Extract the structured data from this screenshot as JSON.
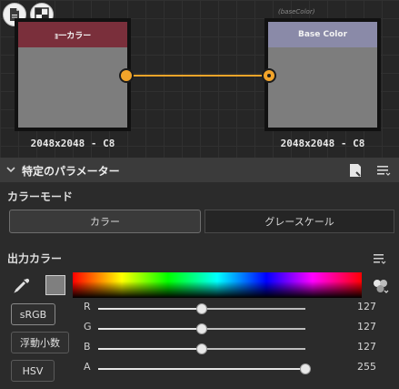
{
  "graph": {
    "left_node": {
      "header_label": "ｮ一カラー",
      "header_color": "#7a2f3b",
      "resolution": "2048x2048 - C8"
    },
    "right_node": {
      "tag": "(baseColor)",
      "header_label": "Base Color",
      "header_color": "#8a8aa8",
      "resolution": "2048x2048 - C8"
    },
    "wire_color": "#f2a42a"
  },
  "panel": {
    "title": "特定のパラメーター",
    "color_mode": {
      "label": "カラーモード",
      "options": [
        "カラー",
        "グレースケール"
      ],
      "selected": "カラー"
    },
    "output_color": {
      "label": "出力カラー",
      "swatch_color": "#7f7f7f",
      "mode_buttons": [
        "sRGB",
        "浮動小数",
        "HSV"
      ],
      "active_mode": "sRGB",
      "sliders": [
        {
          "name": "R",
          "value": "127",
          "fraction": 0.5
        },
        {
          "name": "G",
          "value": "127",
          "fraction": 0.5
        },
        {
          "name": "B",
          "value": "127",
          "fraction": 0.5
        },
        {
          "name": "A",
          "value": "255",
          "fraction": 1.0
        }
      ]
    }
  }
}
